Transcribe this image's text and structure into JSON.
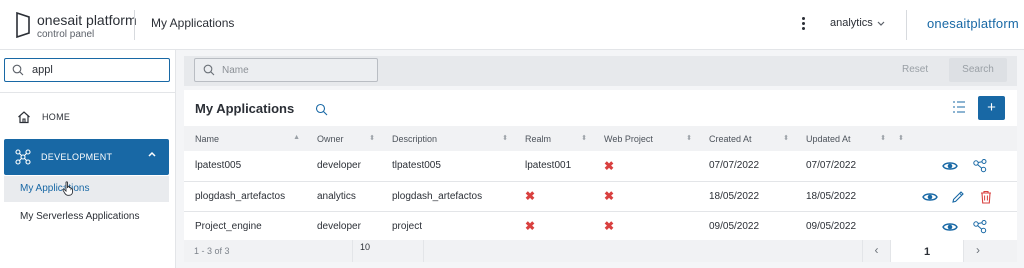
{
  "header": {
    "logo_line1": "onesait platform",
    "logo_line2": "control panel",
    "page_title": "My Applications",
    "user": "analytics",
    "brand": "onesaitplatform"
  },
  "sidebar": {
    "search_value": "appl",
    "home_label": "HOME",
    "section_label": "DEVELOPMENT",
    "items": [
      {
        "label": "My Applications"
      },
      {
        "label": "My Serverless Applications"
      }
    ]
  },
  "filter": {
    "placeholder": "Name",
    "reset_label": "Reset",
    "search_label": "Search"
  },
  "card": {
    "title": "My Applications",
    "add_label": "+"
  },
  "table": {
    "columns": [
      "Name",
      "Owner",
      "Description",
      "Realm",
      "Web Project",
      "Created At",
      "Updated At",
      ""
    ],
    "rows": [
      {
        "name": "lpatest005",
        "owner": "developer",
        "description": "tlpatest005",
        "realm": "lpatest001",
        "web_project": "✖",
        "created": "07/07/2022",
        "updated": "07/07/2022"
      },
      {
        "name": "plogdash_artefactos",
        "owner": "analytics",
        "description": "plogdash_artefactos",
        "realm": "✖",
        "web_project": "✖",
        "created": "18/05/2022",
        "updated": "18/05/2022"
      },
      {
        "name": "Project_engine",
        "owner": "developer",
        "description": "project",
        "realm": "✖",
        "web_project": "✖",
        "created": "09/05/2022",
        "updated": "09/05/2022"
      }
    ]
  },
  "pagination": {
    "range": "1 - 3 of 3",
    "page_size": "10",
    "prev": "‹",
    "page": "1",
    "next": "›"
  },
  "colors": {
    "accent": "#1868a5",
    "danger": "#d9403f"
  }
}
